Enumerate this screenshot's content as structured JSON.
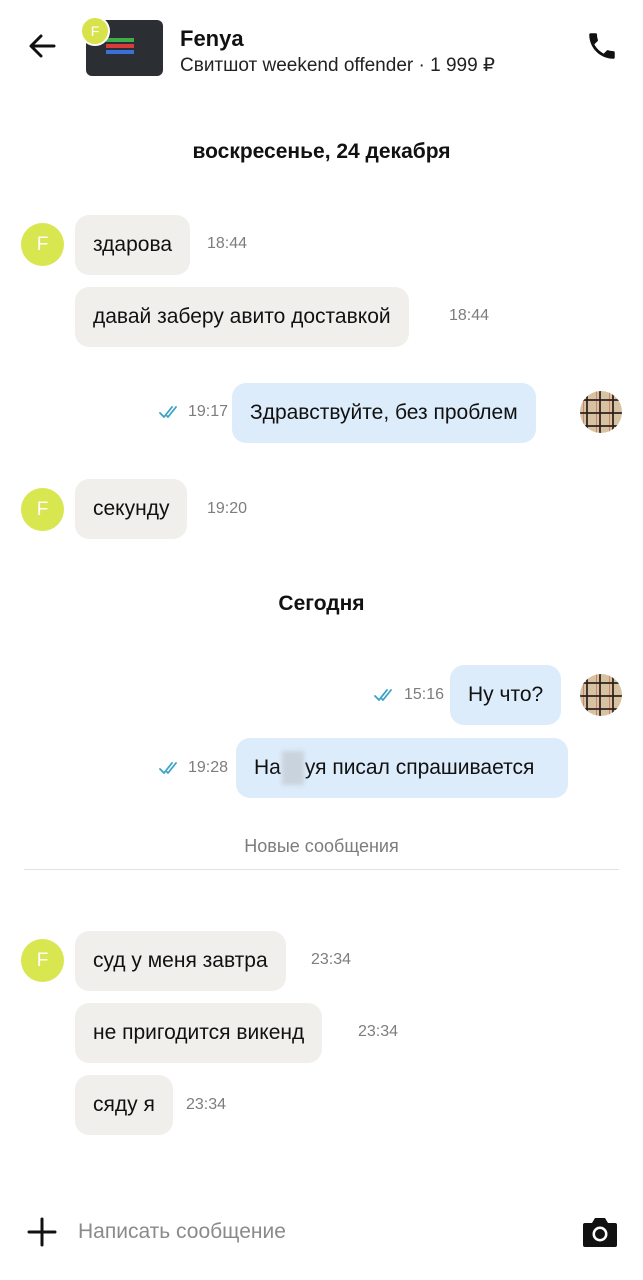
{
  "header": {
    "name": "Fenya",
    "item_title": "Свитшот weekend offender",
    "separator": " · ",
    "price": "1 999 ₽",
    "thumb_avatar_letter": "F"
  },
  "date_separators": {
    "first": "воскресенье, 24 декабря",
    "second": "Сегодня"
  },
  "contact_avatar_letter": "F",
  "messages": [
    {
      "text": "здарова",
      "time": "18:44",
      "direction": "in"
    },
    {
      "text": "давай заберу авито доставкой",
      "time": "18:44",
      "direction": "in"
    },
    {
      "text": "Здравствуйте, без проблем",
      "time": "19:17",
      "direction": "out"
    },
    {
      "text": "секунду",
      "time": "19:20",
      "direction": "in"
    },
    {
      "text": "Ну что?",
      "time": "15:16",
      "direction": "out"
    },
    {
      "text_before": "На",
      "text_after": "уя писал спрашивается",
      "time": "19:28",
      "direction": "out"
    },
    {
      "text": "суд у меня завтра",
      "time": "23:34",
      "direction": "in"
    },
    {
      "text": "не пригодится викенд",
      "time": "23:34",
      "direction": "in"
    },
    {
      "text": "сяду я",
      "time": "23:34",
      "direction": "in"
    }
  ],
  "new_messages_label": "Новые сообщения",
  "composer": {
    "placeholder": "Написать сообщение"
  },
  "icons": {
    "back": "arrow-left-icon",
    "phone": "phone-icon",
    "plus": "plus-icon",
    "camera": "camera-icon",
    "read": "double-check-icon"
  },
  "colors": {
    "incoming_bubble": "#f1efec",
    "outgoing_bubble": "#dcecfb",
    "contact_avatar": "#d8e64f",
    "read_check": "#3aa3c8"
  }
}
